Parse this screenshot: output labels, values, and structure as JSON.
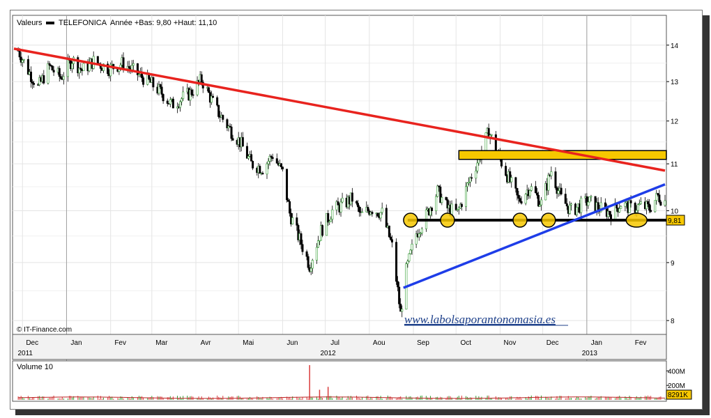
{
  "colors": {
    "accent_red": "#e8231e",
    "accent_blue": "#1e3de8",
    "zone_yellow": "#f7c800",
    "support_black": "#000000",
    "volume_green": "#2e9d2e",
    "volume_red": "#d93b3b",
    "grid": "#e4e4e4"
  },
  "header": {
    "label": "Valeurs",
    "series_name": "TELEFONICA",
    "range_text": "Année +Bas: 9,80 +Haut: 11,10"
  },
  "credit": "© IT-Finance.com",
  "website": "www.labolsaporantonomasia.es",
  "volume_panel": {
    "title": "Volume 10",
    "last_value": "8291K",
    "ticks": [
      {
        "label": "400M",
        "value": 400
      },
      {
        "label": "200M",
        "value": 200
      }
    ]
  },
  "chart_data": {
    "type": "candlestick",
    "title": "",
    "series": [
      {
        "name": "TELEFONICA"
      }
    ],
    "y_scale": "log",
    "ylim": [
      7.8,
      14.5
    ],
    "y_ticks": [
      8,
      9,
      10,
      11,
      12,
      13,
      14
    ],
    "x_range": [
      "2011-11-25",
      "2013-02-25"
    ],
    "x_months": [
      {
        "label": "Dec",
        "date": "2011-12-01"
      },
      {
        "label": "Jan",
        "date": "2012-01-01"
      },
      {
        "label": "Fev",
        "date": "2012-02-01"
      },
      {
        "label": "Mar",
        "date": "2012-03-01"
      },
      {
        "label": "Avr",
        "date": "2012-04-01"
      },
      {
        "label": "Mai",
        "date": "2012-05-01"
      },
      {
        "label": "Jun",
        "date": "2012-06-01"
      },
      {
        "label": "Jul",
        "date": "2012-07-01"
      },
      {
        "label": "Aou",
        "date": "2012-08-01"
      },
      {
        "label": "Sep",
        "date": "2012-09-01"
      },
      {
        "label": "Oct",
        "date": "2012-10-01"
      },
      {
        "label": "Nov",
        "date": "2012-11-01"
      },
      {
        "label": "Dec",
        "date": "2012-12-01"
      },
      {
        "label": "Jan",
        "date": "2013-01-01"
      },
      {
        "label": "Fev",
        "date": "2013-02-01"
      }
    ],
    "x_years": [
      {
        "label": "2011",
        "date": "2011-12-01"
      },
      {
        "label": "2012",
        "date": "2012-07-01"
      },
      {
        "label": "2013",
        "date": "2013-01-01"
      }
    ],
    "price_path": [
      [
        "2011-11-28",
        13.85
      ],
      [
        "2011-12-05",
        13.3
      ],
      [
        "2011-12-12",
        12.85
      ],
      [
        "2011-12-20",
        13.4
      ],
      [
        "2011-12-28",
        13.1
      ],
      [
        "2012-01-05",
        13.6
      ],
      [
        "2012-01-12",
        13.3
      ],
      [
        "2012-01-20",
        13.55
      ],
      [
        "2012-01-31",
        13.35
      ],
      [
        "2012-02-10",
        13.5
      ],
      [
        "2012-02-20",
        13.2
      ],
      [
        "2012-02-28",
        13.0
      ],
      [
        "2012-03-08",
        12.7
      ],
      [
        "2012-03-15",
        12.4
      ],
      [
        "2012-03-28",
        12.7
      ],
      [
        "2012-04-05",
        13.05
      ],
      [
        "2012-04-15",
        12.3
      ],
      [
        "2012-04-25",
        11.8
      ],
      [
        "2012-05-02",
        11.5
      ],
      [
        "2012-05-10",
        11.0
      ],
      [
        "2012-05-18",
        10.9
      ],
      [
        "2012-05-25",
        11.2
      ],
      [
        "2012-06-01",
        10.8
      ],
      [
        "2012-06-06",
        9.95
      ],
      [
        "2012-06-12",
        9.5
      ],
      [
        "2012-06-20",
        8.95
      ],
      [
        "2012-06-28",
        9.6
      ],
      [
        "2012-07-06",
        10.0
      ],
      [
        "2012-07-12",
        10.1
      ],
      [
        "2012-07-20",
        10.25
      ],
      [
        "2012-07-26",
        9.9
      ],
      [
        "2012-08-02",
        10.05
      ],
      [
        "2012-08-10",
        9.95
      ],
      [
        "2012-08-17",
        9.3
      ],
      [
        "2012-08-23",
        8.1
      ],
      [
        "2012-08-27",
        8.85
      ],
      [
        "2012-09-03",
        9.55
      ],
      [
        "2012-09-10",
        9.9
      ],
      [
        "2012-09-18",
        10.4
      ],
      [
        "2012-09-25",
        10.05
      ],
      [
        "2012-10-02",
        9.95
      ],
      [
        "2012-10-10",
        10.6
      ],
      [
        "2012-10-18",
        11.2
      ],
      [
        "2012-10-24",
        11.75
      ],
      [
        "2012-10-30",
        11.25
      ],
      [
        "2012-11-06",
        10.75
      ],
      [
        "2012-11-14",
        10.2
      ],
      [
        "2012-11-22",
        10.5
      ],
      [
        "2012-11-30",
        10.15
      ],
      [
        "2012-12-07",
        10.85
      ],
      [
        "2012-12-14",
        10.25
      ],
      [
        "2012-12-21",
        10.0
      ],
      [
        "2013-01-02",
        10.2
      ],
      [
        "2013-01-10",
        10.05
      ],
      [
        "2013-01-18",
        9.95
      ],
      [
        "2013-01-25",
        10.15
      ],
      [
        "2013-02-01",
        10.05
      ],
      [
        "2013-02-08",
        10.1
      ],
      [
        "2013-02-14",
        10.05
      ],
      [
        "2013-02-20",
        10.3
      ],
      [
        "2013-02-25",
        10.2
      ]
    ],
    "volume_spikes": [
      {
        "date": "2012-06-20",
        "value": 480
      },
      {
        "date": "2012-07-03",
        "value": 180
      },
      {
        "date": "2012-06-27",
        "value": 140
      }
    ],
    "annotations": {
      "resistance_line": {
        "from": [
          "2011-11-25",
          13.9
        ],
        "to": [
          "2013-02-25",
          10.85
        ],
        "color": "#e8231e"
      },
      "support_line": {
        "from": [
          "2012-08-25",
          8.55
        ],
        "to": [
          "2013-02-25",
          10.55
        ],
        "color": "#1e3de8"
      },
      "horizontal_support": {
        "from": "2012-08-28",
        "to": "2013-02-25",
        "value": 9.81,
        "label": "9,81"
      },
      "resistance_zone": {
        "from": "2012-10-03",
        "to": "2013-02-25",
        "low": 11.1,
        "high": 11.3
      },
      "touch_points": [
        "2012-08-30",
        "2012-09-25",
        "2012-11-15",
        "2012-12-05",
        "2013-02-05"
      ]
    }
  }
}
